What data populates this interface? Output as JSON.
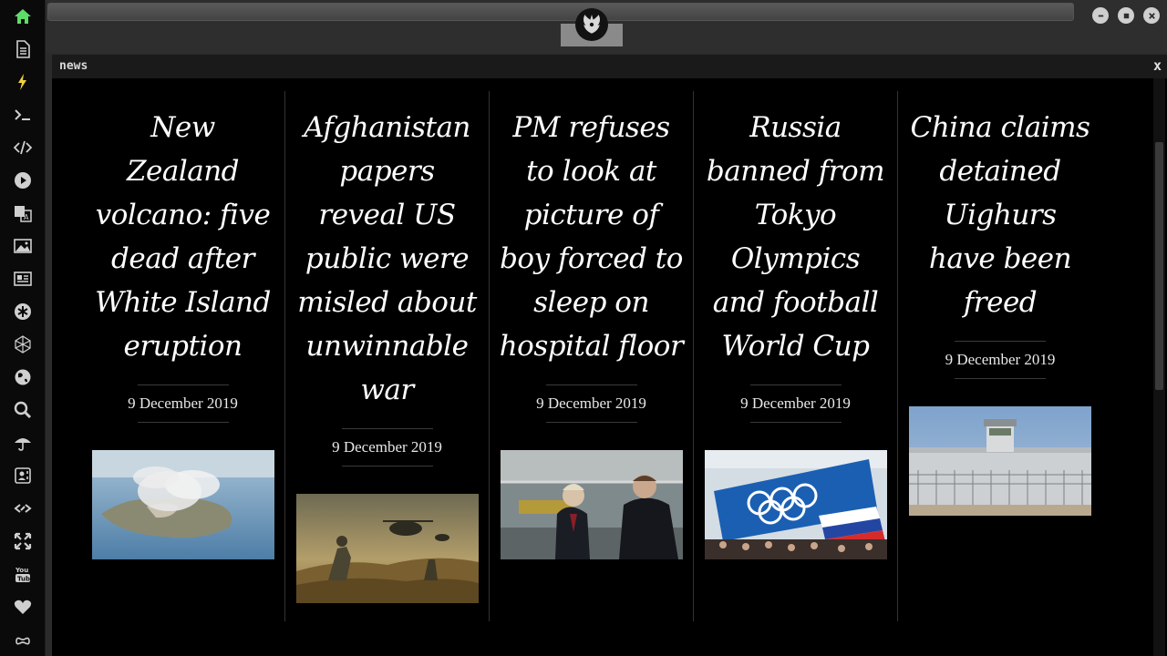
{
  "panel": {
    "title": "news",
    "close_label": "x"
  },
  "sidebar": {
    "items": [
      {
        "name": "home-icon",
        "color": "#5ddc6a"
      },
      {
        "name": "document-icon"
      },
      {
        "name": "lightning-icon",
        "color": "#f2d13c"
      },
      {
        "name": "terminal-icon"
      },
      {
        "name": "code-icon"
      },
      {
        "name": "play-icon"
      },
      {
        "name": "translate-icon"
      },
      {
        "name": "image-icon"
      },
      {
        "name": "newspaper-icon"
      },
      {
        "name": "asterisk-icon"
      },
      {
        "name": "polyhedron-icon"
      },
      {
        "name": "globe-icon"
      },
      {
        "name": "search-icon"
      },
      {
        "name": "umbrella-icon"
      },
      {
        "name": "contact-card-icon"
      },
      {
        "name": "link-icon"
      },
      {
        "name": "expand-icon"
      },
      {
        "name": "youtube-icon"
      },
      {
        "name": "heart-icon"
      },
      {
        "name": "infinity-cloud-icon"
      }
    ]
  },
  "articles": [
    {
      "headline": "New Zealand volcano: five dead after White Island eruption",
      "date": "9 December 2019",
      "image": "volcano-island"
    },
    {
      "headline": "Afghanistan papers reveal US public were misled about unwinnable war",
      "date": "9 December 2019",
      "image": "soldiers-helicopter"
    },
    {
      "headline": "PM refuses to look at picture of boy forced to sleep on hospital floor",
      "date": "9 December 2019",
      "image": "pm-warehouse"
    },
    {
      "headline": "Russia banned from Tokyo Olympics and football World Cup",
      "date": "9 December 2019",
      "image": "olympic-flag"
    },
    {
      "headline": "China claims detained Uighurs have been freed",
      "date": "9 December 2019",
      "image": "detention-wall"
    }
  ]
}
